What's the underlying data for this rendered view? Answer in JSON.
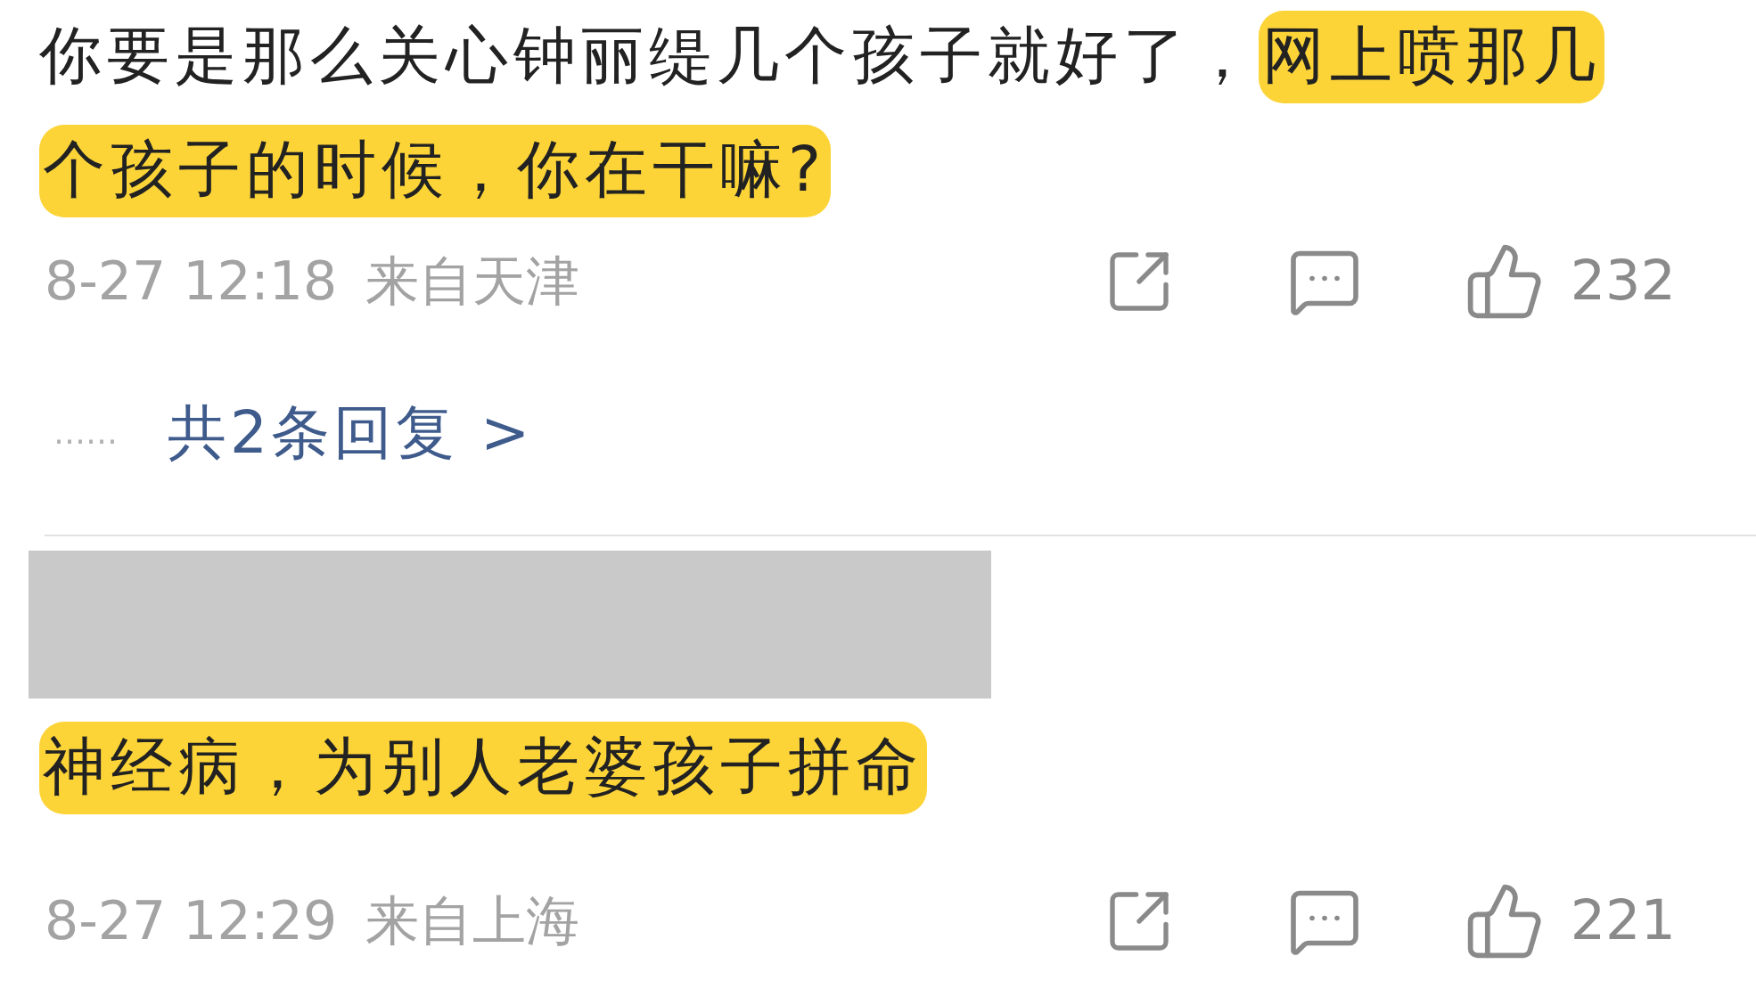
{
  "comments": [
    {
      "segments": [
        {
          "text": "你要是那么关心钟丽缇几个孩子就好了，",
          "highlighted": false
        },
        {
          "text": "网上喷那几个孩子的时候，你在干嘛?",
          "highlighted": true
        }
      ],
      "date": "8-27 12:18",
      "location": "来自天津",
      "likes": "232",
      "replies": {
        "dots": "……",
        "label": "共2条回复 >"
      }
    },
    {
      "segments": [
        {
          "text": "神经病，为别人老婆孩子拼命",
          "highlighted": true
        }
      ],
      "redacted_name": true,
      "date": "8-27 12:29",
      "location": "来自上海",
      "likes": "221"
    }
  ]
}
